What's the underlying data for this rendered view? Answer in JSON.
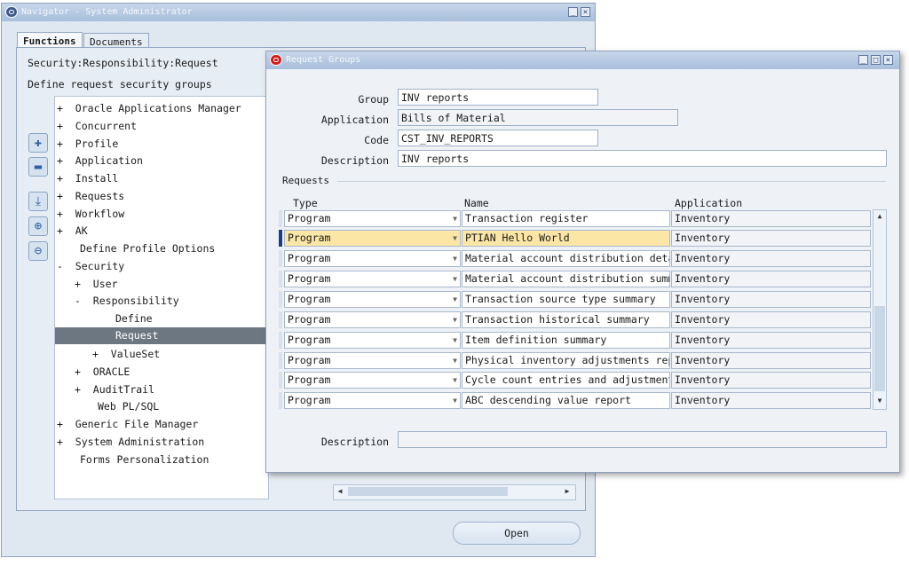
{
  "navigator": {
    "title": "Navigator - System Administrator",
    "tabs": [
      "Functions",
      "Documents"
    ],
    "path_text": "Security:Responsibility:Request",
    "description_text": "Define request security groups",
    "side_buttons": [
      "expand-icon",
      "collapse-icon",
      "expand-branch-icon",
      "expand-all-icon",
      "collapse-all-icon"
    ],
    "tree": [
      {
        "prefix": "+",
        "label": "Oracle Applications Manager"
      },
      {
        "prefix": "+",
        "label": "Concurrent"
      },
      {
        "prefix": "+",
        "label": "Profile"
      },
      {
        "prefix": "+",
        "label": "Application"
      },
      {
        "prefix": "+",
        "label": "Install"
      },
      {
        "prefix": "+",
        "label": "Requests"
      },
      {
        "prefix": "+",
        "label": "Workflow"
      },
      {
        "prefix": "+",
        "label": "AK"
      },
      {
        "prefix": "",
        "label": "Define Profile Options"
      },
      {
        "prefix": "-",
        "label": "Security"
      },
      {
        "prefix": "+",
        "label": "User"
      },
      {
        "prefix": "-",
        "label": "Responsibility"
      },
      {
        "prefix": "",
        "label": "Define"
      },
      {
        "prefix": "",
        "label": "Request"
      },
      {
        "prefix": "+",
        "label": "ValueSet"
      },
      {
        "prefix": "+",
        "label": "ORACLE"
      },
      {
        "prefix": "+",
        "label": "AuditTrail"
      },
      {
        "prefix": "",
        "label": "Web PL/SQL"
      },
      {
        "prefix": "+",
        "label": "Generic File Manager"
      },
      {
        "prefix": "+",
        "label": "System Administration"
      },
      {
        "prefix": "",
        "label": "Forms Personalization"
      }
    ],
    "open_label": "Open"
  },
  "request_groups": {
    "title": "Request Groups",
    "group_label": "Group",
    "group_value": "INV reports",
    "application_label": "Application",
    "application_value": "Bills of Material",
    "code_label": "Code",
    "code_value": "CST_INV_REPORTS",
    "description_label": "Description",
    "description_value": "INV reports",
    "requests_section": "Requests",
    "columns": [
      "Type",
      "Name",
      "Application"
    ],
    "rows": [
      {
        "type": "Program",
        "name": "Transaction register",
        "application": "Inventory"
      },
      {
        "type": "Program",
        "name": "PTIAN Hello World",
        "application": "Inventory"
      },
      {
        "type": "Program",
        "name": "Material account distribution detai",
        "application": "Inventory"
      },
      {
        "type": "Program",
        "name": "Material account distribution summa",
        "application": "Inventory"
      },
      {
        "type": "Program",
        "name": "Transaction source type summary",
        "application": "Inventory"
      },
      {
        "type": "Program",
        "name": "Transaction historical summary",
        "application": "Inventory"
      },
      {
        "type": "Program",
        "name": "Item definition summary",
        "application": "Inventory"
      },
      {
        "type": "Program",
        "name": "Physical inventory adjustments repo",
        "application": "Inventory"
      },
      {
        "type": "Program",
        "name": "Cycle count entries and adjustments",
        "application": "Inventory"
      },
      {
        "type": "Program",
        "name": "ABC descending value report",
        "application": "Inventory"
      }
    ],
    "current_row_index": 1,
    "footer_description_label": "Description",
    "footer_description_value": ""
  },
  "colors": {
    "current_row": "#fbe6a5",
    "selected_tree_item": "#6d7782",
    "title_bar": "#a8bedb"
  }
}
